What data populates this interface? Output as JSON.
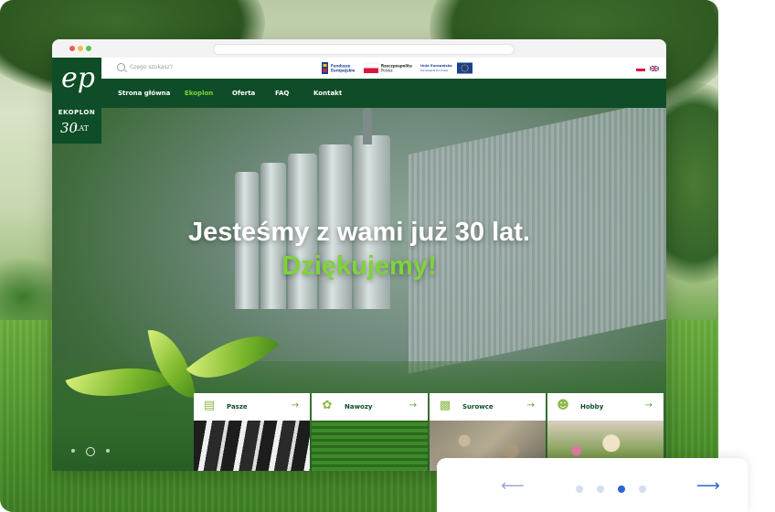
{
  "search": {
    "placeholder": "Czego szukasz?"
  },
  "funding_logos": [
    {
      "name": "Fundusze Europejskie",
      "line1": "Fundusze",
      "line2": "Europejskie"
    },
    {
      "name": "Rzeczpospolita Polska",
      "line1": "Rzeczpospolita",
      "line2": "Polska"
    },
    {
      "name": "Unia Europejska",
      "line1": "Unia Europejska",
      "line2": "Europejskie Fundusze"
    }
  ],
  "brand": {
    "name": "EKOPLON",
    "anniversary_number": "30",
    "anniversary_word": "LAT",
    "monogram": "ep"
  },
  "nav": {
    "items": [
      {
        "label": "Strona główna",
        "active": false
      },
      {
        "label": "Ekoplon",
        "active": true
      },
      {
        "label": "Oferta",
        "active": false
      },
      {
        "label": "FAQ",
        "active": false
      },
      {
        "label": "Kontakt",
        "active": false
      }
    ]
  },
  "hero": {
    "headline": "Jesteśmy z wami już 30 lat.",
    "subheadline": "Dziękujemy!",
    "slides_total": 3,
    "slide_active": 2
  },
  "categories": [
    {
      "label": "Pasze",
      "icon": "feed-bag-icon"
    },
    {
      "label": "Nawozy",
      "icon": "sprout-icon"
    },
    {
      "label": "Surowce",
      "icon": "factory-icon"
    },
    {
      "label": "Hobby",
      "icon": "rabbit-icon"
    }
  ],
  "carousel": {
    "total": 4,
    "active": 3
  },
  "colors": {
    "brand_green": "#0e4d27",
    "accent_green": "#7fd33b",
    "accent_blue": "#2b63d9"
  }
}
